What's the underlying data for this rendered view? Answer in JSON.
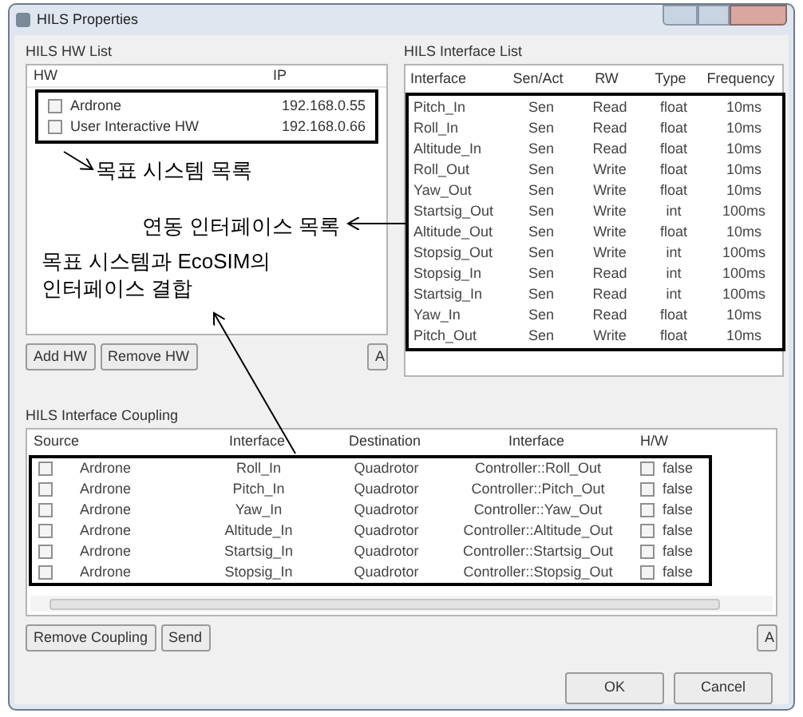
{
  "window": {
    "title": "HILS Properties"
  },
  "hw_list": {
    "title": "HILS HW List",
    "columns": [
      "HW",
      "IP"
    ],
    "rows": [
      {
        "checked": false,
        "cells": [
          "Ardrone",
          "192.168.0.55"
        ]
      },
      {
        "checked": false,
        "cells": [
          "User Interactive HW",
          "192.168.0.66"
        ]
      }
    ],
    "buttons": [
      "Add HW",
      "Remove HW"
    ],
    "corner_button": "A"
  },
  "interface_list": {
    "title": "HILS Interface List",
    "columns": [
      "Interface",
      "Sen/Act",
      "RW",
      "Type",
      "Frequency"
    ],
    "rows": [
      [
        "Pitch_In",
        "Sen",
        "Read",
        "float",
        "10ms"
      ],
      [
        "Roll_In",
        "Sen",
        "Read",
        "float",
        "10ms"
      ],
      [
        "Altitude_In",
        "Sen",
        "Read",
        "float",
        "10ms"
      ],
      [
        "Roll_Out",
        "Sen",
        "Write",
        "float",
        "10ms"
      ],
      [
        "Yaw_Out",
        "Sen",
        "Write",
        "float",
        "10ms"
      ],
      [
        "Startsig_Out",
        "Sen",
        "Write",
        "int",
        "100ms"
      ],
      [
        "Altitude_Out",
        "Sen",
        "Write",
        "float",
        "10ms"
      ],
      [
        "Stopsig_Out",
        "Sen",
        "Write",
        "int",
        "100ms"
      ],
      [
        "Stopsig_In",
        "Sen",
        "Read",
        "int",
        "100ms"
      ],
      [
        "Startsig_In",
        "Sen",
        "Read",
        "int",
        "100ms"
      ],
      [
        "Yaw_In",
        "Sen",
        "Read",
        "float",
        "10ms"
      ],
      [
        "Pitch_Out",
        "Sen",
        "Write",
        "float",
        "10ms"
      ]
    ]
  },
  "coupling": {
    "title": "HILS Interface Coupling",
    "columns": [
      "Source",
      "Interface",
      "Destination",
      "Interface",
      "H/W"
    ],
    "rows": [
      {
        "checked": false,
        "cells": [
          "Ardrone",
          "Roll_In",
          "Quadrotor",
          "Controller::Roll_Out"
        ],
        "hw_checked": false,
        "hw_value": "false"
      },
      {
        "checked": false,
        "cells": [
          "Ardrone",
          "Pitch_In",
          "Quadrotor",
          "Controller::Pitch_Out"
        ],
        "hw_checked": false,
        "hw_value": "false"
      },
      {
        "checked": false,
        "cells": [
          "Ardrone",
          "Yaw_In",
          "Quadrotor",
          "Controller::Yaw_Out"
        ],
        "hw_checked": false,
        "hw_value": "false"
      },
      {
        "checked": false,
        "cells": [
          "Ardrone",
          "Altitude_In",
          "Quadrotor",
          "Controller::Altitude_Out"
        ],
        "hw_checked": false,
        "hw_value": "false"
      },
      {
        "checked": false,
        "cells": [
          "Ardrone",
          "Startsig_In",
          "Quadrotor",
          "Controller::Startsig_Out"
        ],
        "hw_checked": false,
        "hw_value": "false"
      },
      {
        "checked": false,
        "cells": [
          "Ardrone",
          "Stopsig_In",
          "Quadrotor",
          "Controller::Stopsig_Out"
        ],
        "hw_checked": false,
        "hw_value": "false"
      }
    ],
    "buttons": [
      "Remove Coupling",
      "Send"
    ],
    "corner_button": "A"
  },
  "dialog_buttons": [
    "OK",
    "Cancel"
  ],
  "annotations": [
    "목표 시스템 목록",
    "연동 인터페이스 목록",
    "목표 시스템과 EcoSIM의\n인터페이스 결합"
  ]
}
